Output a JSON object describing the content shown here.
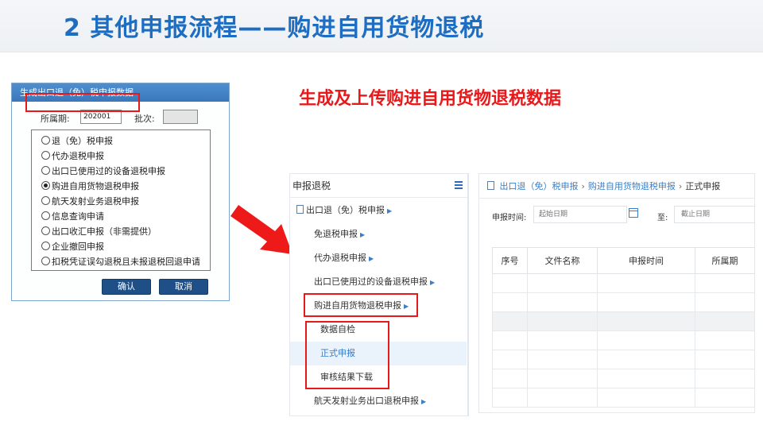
{
  "slide": {
    "title": "2 其他申报流程——购进自用货物退税",
    "subtitle": "生成及上传购进自用货物退税数据"
  },
  "dialog": {
    "title": "生成出口退（免）税申报数据",
    "period_label": "所属期:",
    "period_value": "202001",
    "batch_label": "批次:",
    "batch_value": "",
    "options": [
      {
        "label": "退（免）税申报",
        "selected": false
      },
      {
        "label": "代办退税申报",
        "selected": false
      },
      {
        "label": "出口已使用过的设备退税申报",
        "selected": false
      },
      {
        "label": "购进自用货物退税申报",
        "selected": true
      },
      {
        "label": "航天发射业务退税申报",
        "selected": false
      },
      {
        "label": "信息查询申请",
        "selected": false
      },
      {
        "label": "出口收汇申报（非需提供）",
        "selected": false
      },
      {
        "label": "企业撤回申报",
        "selected": false
      },
      {
        "label": "扣税凭证误勾退税且未报退税回退申请",
        "selected": false
      }
    ],
    "ok_label": "确认",
    "cancel_label": "取消"
  },
  "nav": {
    "header": "申报退税",
    "items": [
      {
        "label": "出口退（免）税申报",
        "level": 1,
        "icon": "document-icon"
      },
      {
        "label": "免退税申报",
        "level": 2
      },
      {
        "label": "代办退税申报",
        "level": 2
      },
      {
        "label": "出口已使用过的设备退税申报",
        "level": 2
      },
      {
        "label": "购进自用货物退税申报",
        "level": 2
      },
      {
        "label": "数据自检",
        "level": 3
      },
      {
        "label": "正式申报",
        "level": 3,
        "active": true
      },
      {
        "label": "审核结果下载",
        "level": 3
      },
      {
        "label": "航天发射业务出口退税申报",
        "level": 2
      }
    ]
  },
  "main": {
    "breadcrumb": [
      "出口退（免）税申报",
      "购进自用货物退税申报",
      "正式申报"
    ],
    "date_label": "申报时间:",
    "start_placeholder": "起始日期",
    "to_label": "至:",
    "end_placeholder": "截止日期",
    "table": {
      "columns": [
        "序号",
        "文件名称",
        "申报时间",
        "所属期"
      ],
      "rows": 7
    }
  },
  "colors": {
    "title_blue": "#1d6ec2",
    "highlight_red": "#e8191b",
    "dialog_header": "#3a78bb",
    "button_navy": "#1e4f87",
    "link_blue": "#3a7fc7"
  }
}
